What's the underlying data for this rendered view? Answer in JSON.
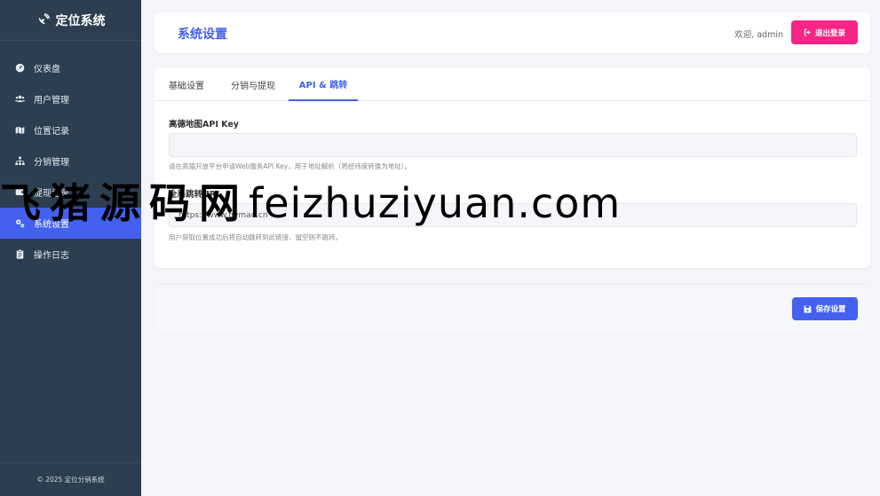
{
  "sidebar": {
    "brand": "定位系统",
    "items": [
      {
        "label": "仪表盘",
        "icon": "dashboard-icon"
      },
      {
        "label": "用户管理",
        "icon": "users-icon"
      },
      {
        "label": "位置记录",
        "icon": "map-icon"
      },
      {
        "label": "分销管理",
        "icon": "sitemap-icon"
      },
      {
        "label": "提现记录",
        "icon": "wallet-icon"
      },
      {
        "label": "系统设置",
        "icon": "gears-icon",
        "active": true
      },
      {
        "label": "操作日志",
        "icon": "clipboard-icon"
      }
    ],
    "footer": "© 2025 定位分销系统"
  },
  "header": {
    "title": "系统设置",
    "welcome": "欢迎, admin",
    "logout_label": "退出登录"
  },
  "tabs": [
    {
      "label": "基础设置"
    },
    {
      "label": "分销与提现"
    },
    {
      "label": "API & 跳转",
      "active": true
    }
  ],
  "form": {
    "amap_key_label": "高德地图API Key",
    "amap_key_value": "",
    "amap_key_help": "请在高德开放平台申请Web服务API Key，用于地址解析（将经纬度转换为地址）。",
    "redirect_url_label": "全局跳转URL",
    "redirect_url_value": "https://www.qymao.cn",
    "redirect_url_help": "用户获取位置成功后将自动跳转到此链接，留空则不跳转。"
  },
  "actions": {
    "save_label": "保存设置"
  },
  "watermark": {
    "cn": "飞猪源码网",
    "en": "feizhuziyuan.com"
  },
  "colors": {
    "sidebar_bg": "#2c3e50",
    "accent": "#4361ee",
    "danger": "#f72585"
  }
}
